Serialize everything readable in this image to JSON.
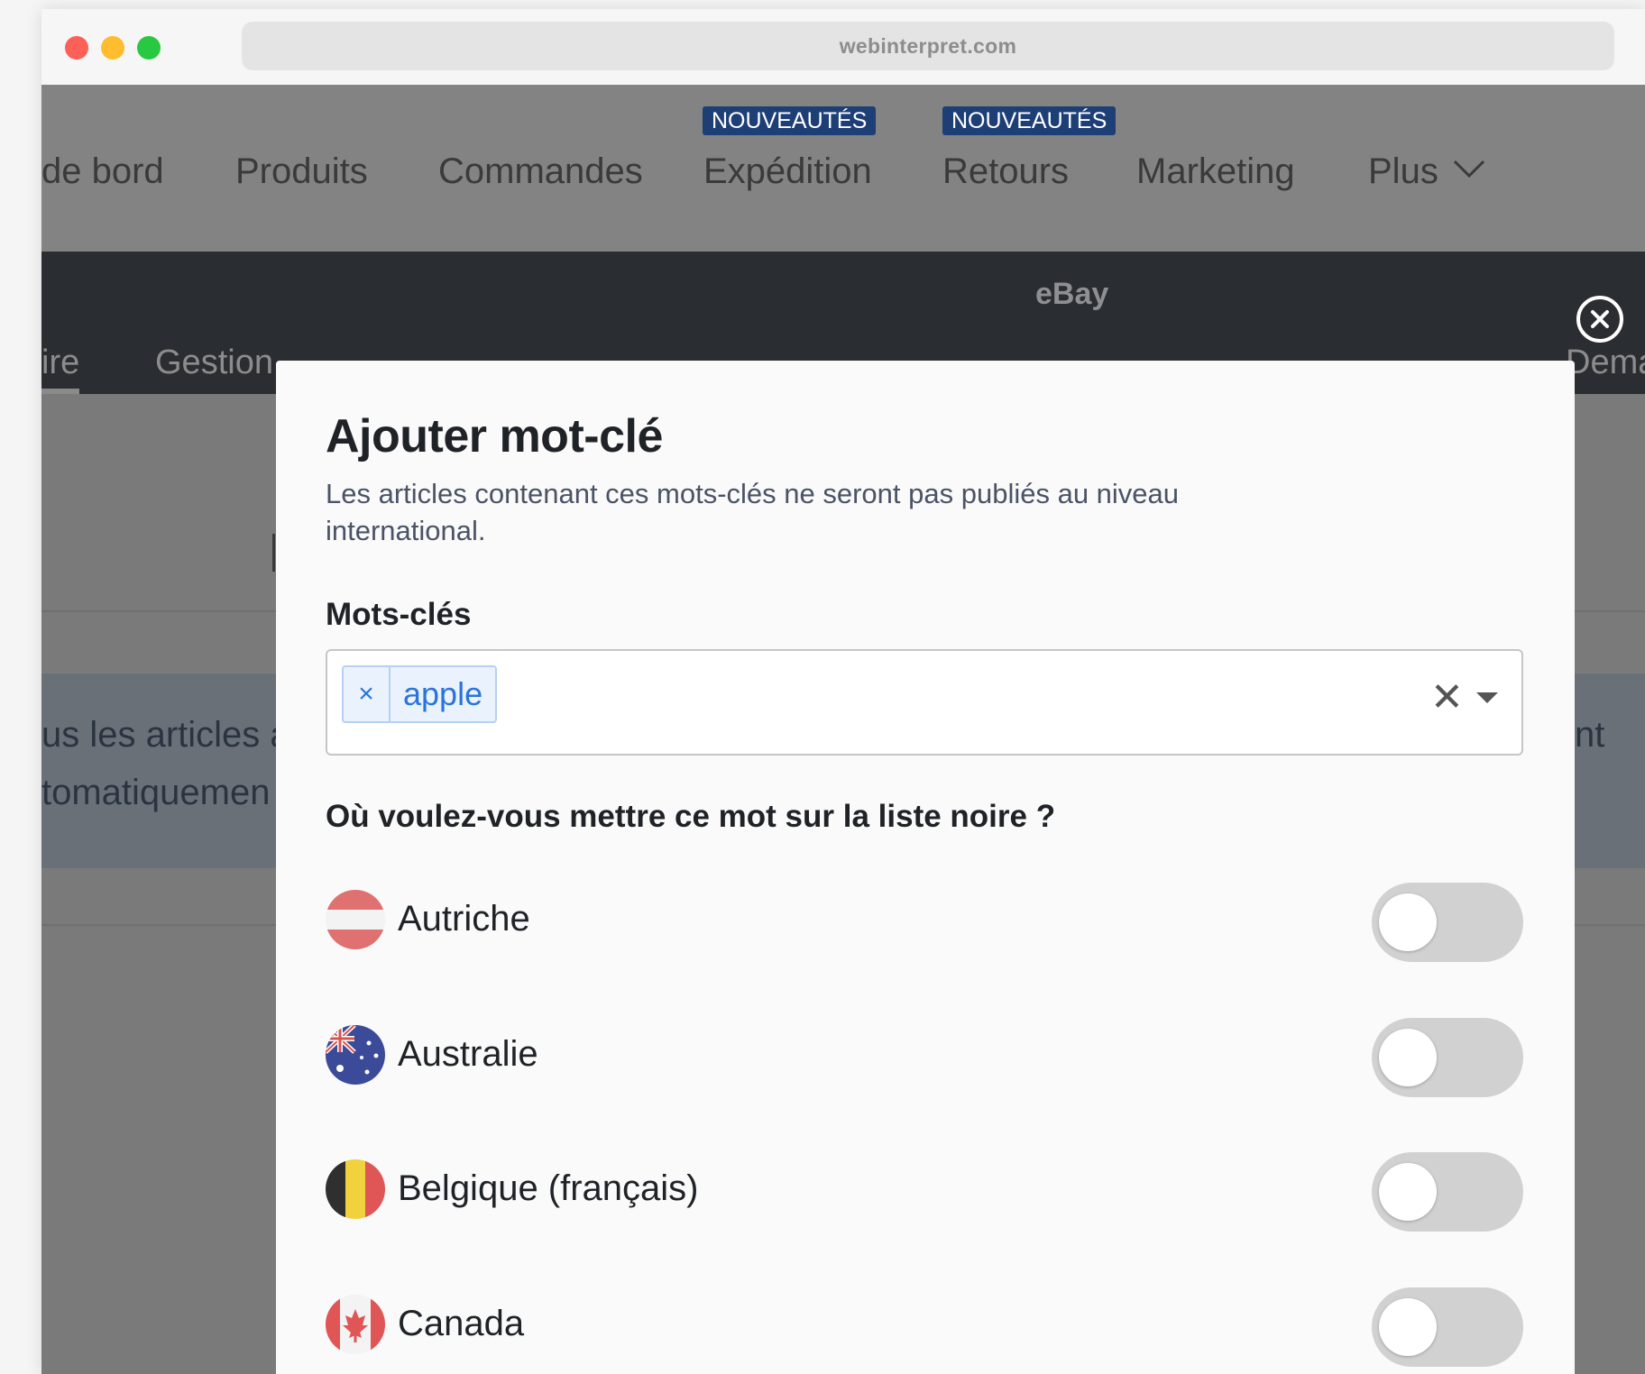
{
  "browser": {
    "url": "webinterpret.com"
  },
  "topnav": {
    "items": [
      {
        "label": "de bord"
      },
      {
        "label": "Produits"
      },
      {
        "label": "Commandes"
      },
      {
        "label": "Expédition",
        "badge": "NOUVEAUTÉS"
      },
      {
        "label": "Retours",
        "badge": "NOUVEAUTÉS"
      },
      {
        "label": "Marketing"
      },
      {
        "label": "Plus"
      }
    ]
  },
  "subheader": {
    "title": "eBay",
    "tabs": [
      {
        "label": "ire"
      },
      {
        "label": "Gestion"
      },
      {
        "label": "Dema"
      }
    ]
  },
  "background": {
    "info_line1_left": "us les articles a",
    "info_line2_left": "tomatiquemen",
    "info_line1_right": "nt"
  },
  "modal": {
    "title": "Ajouter mot-clé",
    "description": "Les articles contenant ces mots-clés ne seront pas publiés au niveau international.",
    "keywords_label": "Mots-clés",
    "keywords": [
      {
        "remove": "×",
        "label": "apple"
      }
    ],
    "clear_symbol": "✕",
    "question": "Où voulez-vous mettre ce mot sur la liste noire ?",
    "countries": [
      {
        "name": "Autriche",
        "flag": "austria-flag-icon",
        "enabled": false
      },
      {
        "name": "Australie",
        "flag": "australia-flag-icon",
        "enabled": false
      },
      {
        "name": "Belgique (français)",
        "flag": "belgium-flag-icon",
        "enabled": false
      },
      {
        "name": "Canada",
        "flag": "canada-flag-icon",
        "enabled": false
      }
    ]
  },
  "colors": {
    "badge": "#1d3f76",
    "tag_text": "#2b74d9",
    "toggle_off": "#d1d1d1"
  }
}
